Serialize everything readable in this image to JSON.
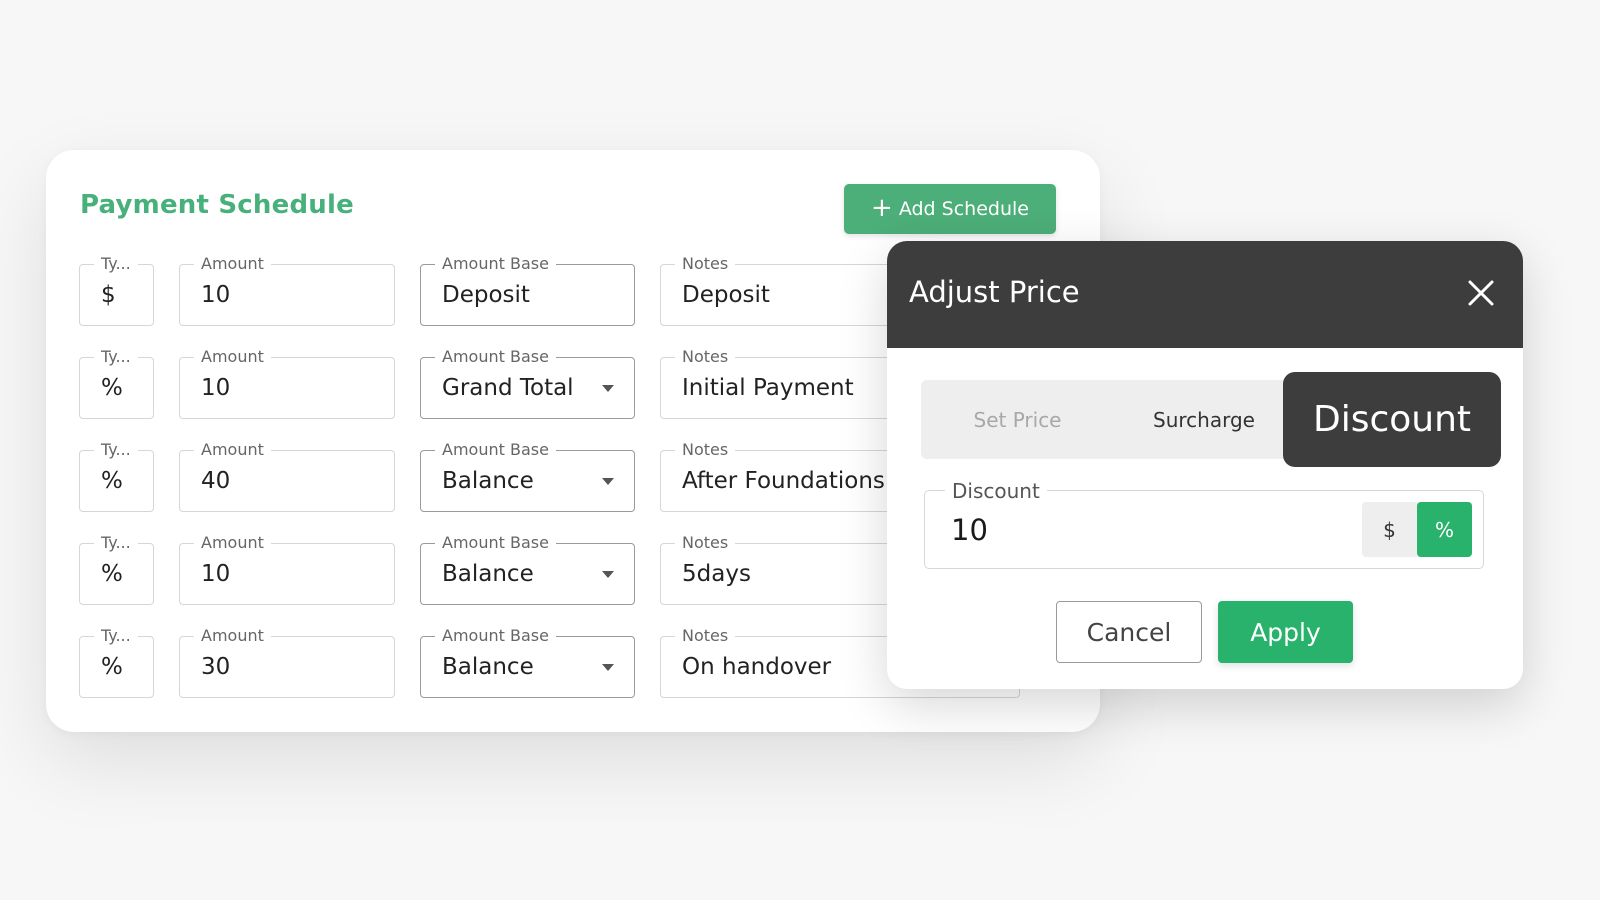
{
  "schedule": {
    "title": "Payment Schedule",
    "add_button": "Add Schedule",
    "labels": {
      "type": "Ty...",
      "amount": "Amount",
      "amount_base": "Amount Base",
      "notes": "Notes"
    },
    "rows": [
      {
        "type": "$",
        "amount": "10",
        "amount_base": "Deposit",
        "notes": "Deposit"
      },
      {
        "type": "%",
        "amount": "10",
        "amount_base": "Grand Total",
        "notes": "Initial Payment"
      },
      {
        "type": "%",
        "amount": "40",
        "amount_base": "Balance",
        "notes": "After Foundations"
      },
      {
        "type": "%",
        "amount": "10",
        "amount_base": "Balance",
        "notes": "5days"
      },
      {
        "type": "%",
        "amount": "30",
        "amount_base": "Balance",
        "notes": "On handover"
      }
    ]
  },
  "modal": {
    "title": "Adjust Price",
    "tabs": {
      "set_price": "Set Price",
      "surcharge": "Surcharge",
      "discount": "Discount"
    },
    "active_tab": "Discount",
    "discount_field": {
      "label": "Discount",
      "value": "10",
      "units": [
        "$",
        "%"
      ],
      "selected_unit": "%"
    },
    "cancel": "Cancel",
    "apply": "Apply"
  },
  "colors": {
    "accent_green": "#4cae78",
    "button_green": "#28b26c",
    "dark_header": "#3d3d3d"
  },
  "icons": [
    "plus-icon",
    "close-icon",
    "caret-down-icon"
  ]
}
